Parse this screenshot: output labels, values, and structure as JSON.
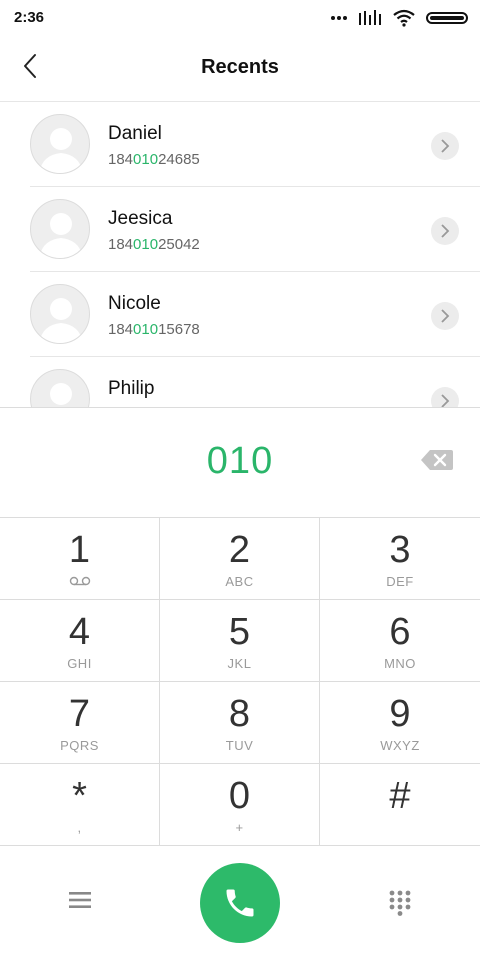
{
  "status_bar": {
    "time": "2:36",
    "icons": [
      "more-dots-icon",
      "signal-icon",
      "wifi-icon",
      "battery-icon"
    ]
  },
  "header": {
    "title": "Recents",
    "back_icon": "chevron-left-icon"
  },
  "contacts": [
    {
      "name": "Daniel",
      "number_prefix": "184",
      "number_match": "010",
      "number_suffix": "24685"
    },
    {
      "name": "Jeesica",
      "number_prefix": "184",
      "number_match": "010",
      "number_suffix": "25042"
    },
    {
      "name": "Nicole",
      "number_prefix": "184",
      "number_match": "010",
      "number_suffix": "15678"
    },
    {
      "name": "Philip",
      "number_prefix": "",
      "number_match": "",
      "number_suffix": ""
    }
  ],
  "dialer": {
    "entered_digits": "010",
    "backspace_icon": "backspace-icon"
  },
  "keypad": [
    {
      "digit": "1",
      "letters": "",
      "sub_icon": "voicemail-icon"
    },
    {
      "digit": "2",
      "letters": "ABC"
    },
    {
      "digit": "3",
      "letters": "DEF"
    },
    {
      "digit": "4",
      "letters": "GHI"
    },
    {
      "digit": "5",
      "letters": "JKL"
    },
    {
      "digit": "6",
      "letters": "MNO"
    },
    {
      "digit": "7",
      "letters": "PQRS"
    },
    {
      "digit": "8",
      "letters": "TUV"
    },
    {
      "digit": "9",
      "letters": "WXYZ"
    },
    {
      "digit": "*",
      "letters": ","
    },
    {
      "digit": "0",
      "letters": "+"
    },
    {
      "digit": "#",
      "letters": ""
    }
  ],
  "bottom_bar": {
    "menu_icon": "hamburger-menu-icon",
    "call_icon": "phone-icon",
    "keypad_toggle_icon": "dialpad-grid-icon"
  },
  "colors": {
    "accent_green": "#2ab56a",
    "call_button": "#2dba6a",
    "divider": "#dcdcdc"
  }
}
